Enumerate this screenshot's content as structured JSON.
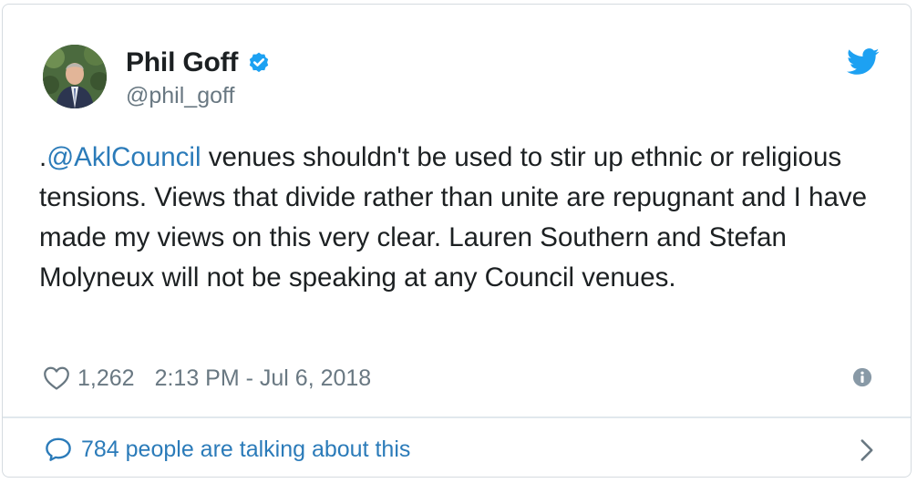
{
  "tweet": {
    "author_name": "Phil Goff",
    "author_handle": "@phil_goff",
    "text_prefix": ".",
    "mention": "@AklCouncil",
    "text_body": " venues shouldn't be used to stir up ethnic or religious tensions. Views that divide rather than unite are repugnant and I have made my views on this very clear. Lauren Southern and Stefan Molyneux will not be speaking at any Council venues.",
    "likes": "1,262",
    "timestamp": "2:13 PM - Jul 6, 2018",
    "conversation_label": "784 people are talking about this"
  },
  "colors": {
    "accent": "#1da1f2",
    "link": "#2b7bb9",
    "muted": "#697882",
    "text": "#1c2022",
    "border": "#d5dbe0"
  },
  "icons": {
    "verified": "verified-badge-icon",
    "brand": "twitter-bird-icon",
    "like": "heart-icon",
    "info": "info-icon",
    "reply": "speech-bubble-icon",
    "more": "chevron-right-icon"
  }
}
